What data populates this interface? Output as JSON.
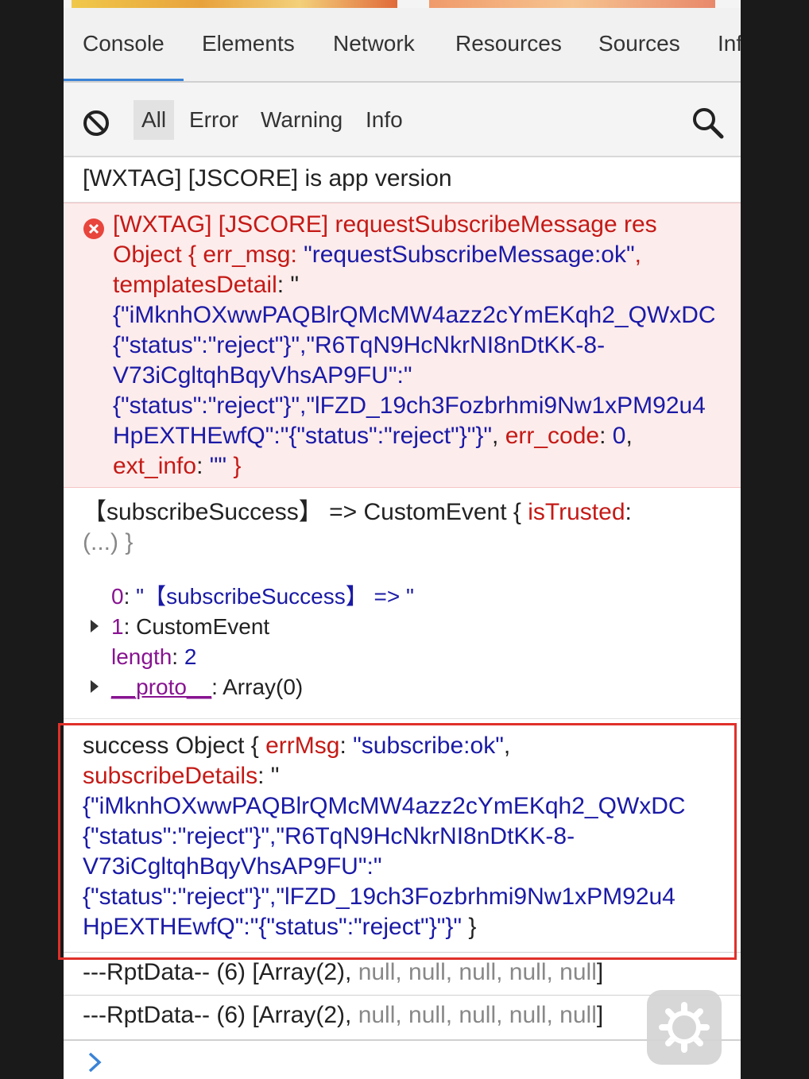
{
  "tabs": [
    "Console",
    "Elements",
    "Network",
    "Resources",
    "Sources",
    "Inf"
  ],
  "filters": [
    "All",
    "Error",
    "Warning",
    "Info"
  ],
  "log_app_version": "[WXTAG] [JSCORE] is app version",
  "error_entry": {
    "l1": "[WXTAG] [JSCORE] requestSubscribeMessage res",
    "l2a": "Object { ",
    "l2b": "err_msg",
    "l2c": ": ",
    "l2d": "\"requestSubscribeMessage:ok\"",
    "l2e": ",",
    "l3a": "templatesDetail",
    "l3b": ": \"",
    "l4": "{\"iMknhOXwwPAQBlrQMcMW4azz2cYmEKqh2_QWxDC",
    "l5": "{\"status\":\"reject\"}\",\"R6TqN9HcNkrNI8nDtKK-8-",
    "l6": "V73iCgltqhBqyVhsAP9FU\":\"",
    "l7": "{\"status\":\"reject\"}\",\"lFZD_19ch3Fozbrhmi9Nw1xPM92u4",
    "l8a": "HpEXTHEwfQ\":\"{\"status\":\"reject\"}\"}\"",
    "l8b": ", ",
    "l8c": "err_code",
    "l8d": ": ",
    "l8e": "0",
    "l8f": ",",
    "l9a": "ext_info",
    "l9b": ": ",
    "l9c": "\"\"",
    "l9d": " }"
  },
  "custom_entry": {
    "h1a": "【subscribeSuccess】 => ",
    "h1b": " CustomEvent { ",
    "h1c": "isTrusted",
    "h1d": ":",
    "h2": "(...) }",
    "t0_key": "0",
    "t0_sep": ": ",
    "t0_val": "\"【subscribeSuccess】 => \"",
    "t1_key": "1",
    "t1_sep": ": ",
    "t1_val": "CustomEvent",
    "t2_key": "length",
    "t2_sep": ": ",
    "t2_val": "2",
    "t3_key": "__proto__",
    "t3_sep": ": ",
    "t3_val": "Array(0)"
  },
  "success_entry": {
    "s1a": "success Object { ",
    "s1b": "errMsg",
    "s1c": ": ",
    "s1d": "\"subscribe:ok\"",
    "s1e": ",",
    "s2a": "subscribeDetails",
    "s2b": ": \"",
    "s3": "{\"iMknhOXwwPAQBlrQMcMW4azz2cYmEKqh2_QWxDC",
    "s4": "{\"status\":\"reject\"}\",\"R6TqN9HcNkrNI8nDtKK-8-",
    "s5": "V73iCgltqhBqyVhsAP9FU\":\"",
    "s6": "{\"status\":\"reject\"}\",\"lFZD_19ch3Fozbrhmi9Nw1xPM92u4",
    "s7a": "HpEXTHEwfQ\":\"{\"status\":\"reject\"}\"}\"",
    "s7b": " }"
  },
  "rpt_line": {
    "prefix": "---RptData-- (6) [Array(2), ",
    "nulls": "null, null, null, null, null",
    "suffix": "]"
  },
  "colors": {
    "error_bg": "#fdecec",
    "error_text": "#c41a16",
    "string_blue": "#1a1aa6",
    "key_purple": "#881391",
    "active_tab_underline": "#3b83d6",
    "highlight_box": "#e0302a"
  },
  "icons": {
    "clear": "clear-console-icon",
    "search": "search-icon",
    "error": "error-icon",
    "expand": "expand-triangle-icon",
    "prompt": "chevron-right-icon",
    "settings": "settings-tool-icon"
  }
}
